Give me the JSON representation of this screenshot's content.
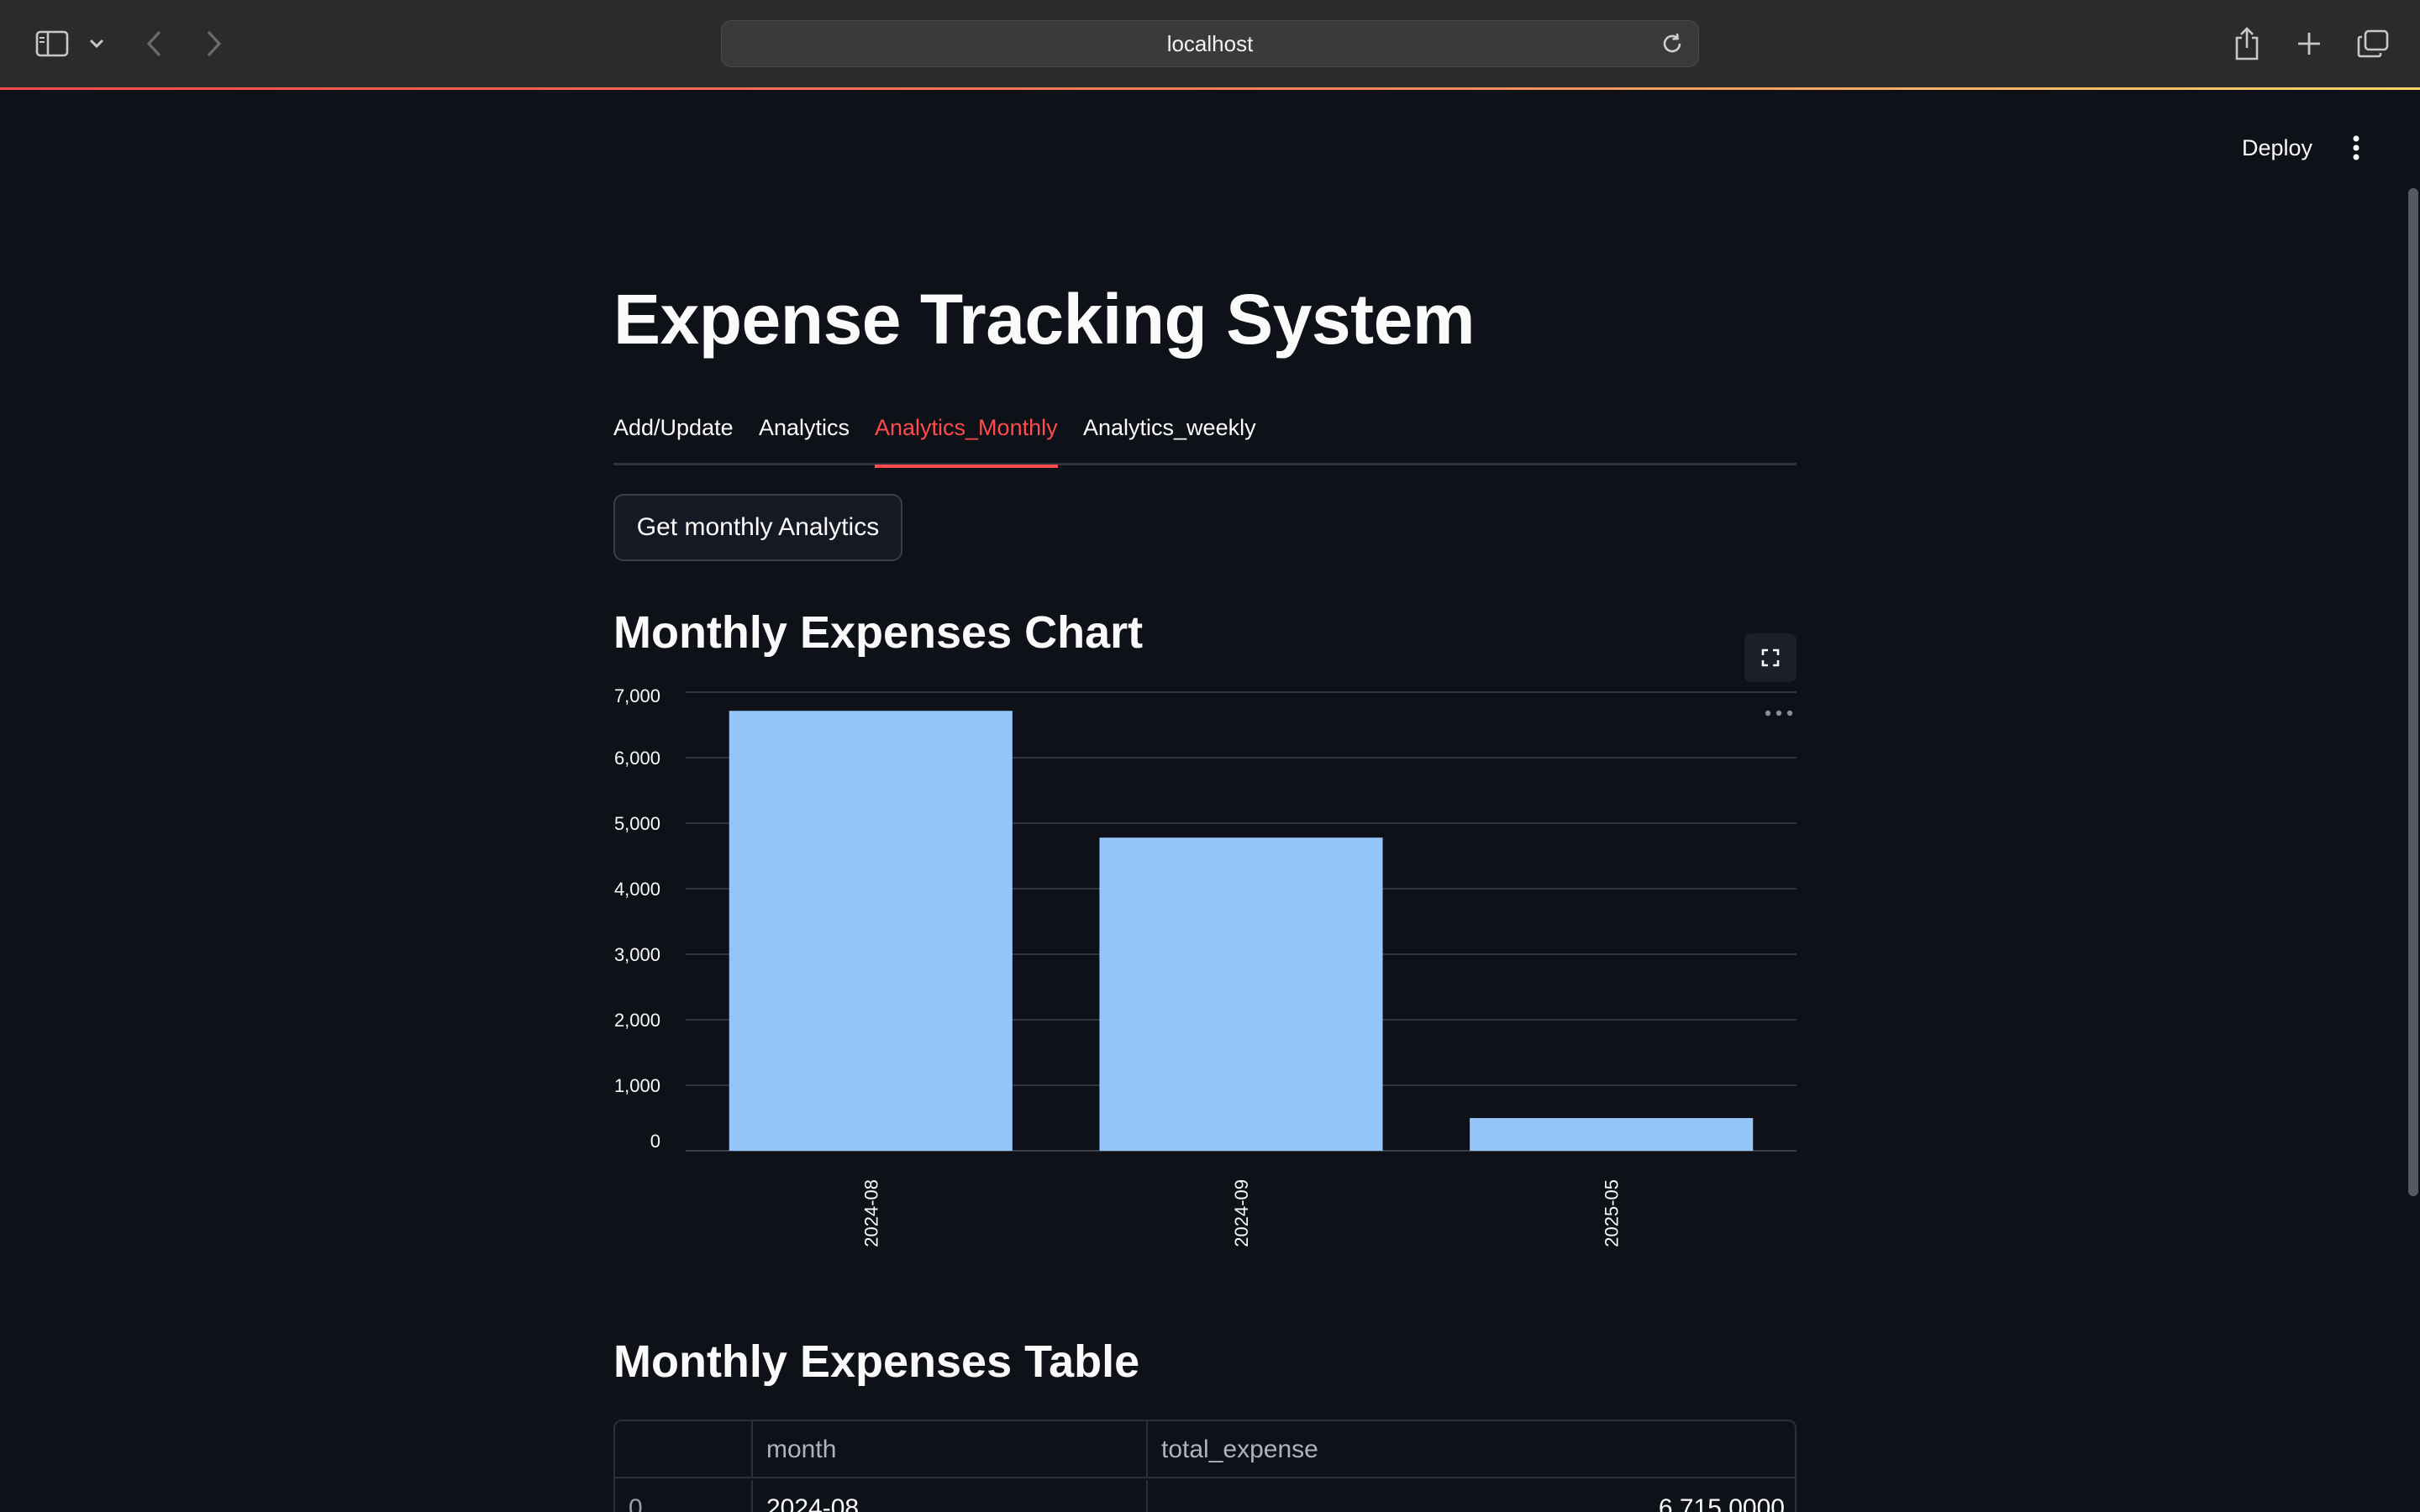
{
  "browser": {
    "address": "localhost"
  },
  "header": {
    "deploy_label": "Deploy"
  },
  "app": {
    "title": "Expense Tracking System",
    "tabs": [
      {
        "label": "Add/Update",
        "active": false
      },
      {
        "label": "Analytics",
        "active": false
      },
      {
        "label": "Analytics_Monthly",
        "active": true
      },
      {
        "label": "Analytics_weekly",
        "active": false
      }
    ],
    "button_label": "Get monthly Analytics",
    "chart_heading": "Monthly Expenses Chart",
    "table_heading": "Monthly Expenses Table",
    "table": {
      "columns": [
        "",
        "month",
        "total_expense"
      ],
      "rows": [
        {
          "index": "0",
          "month": "2024-08",
          "total_expense": "6,715.0000"
        }
      ]
    }
  },
  "colors": {
    "accent": "#ff4b4b",
    "bar": "#93c5f8",
    "background": "#0e1117"
  },
  "icons": [
    "sidebar-icon",
    "chevron-down-icon",
    "back-icon",
    "forward-icon",
    "reload-icon",
    "share-icon",
    "new-tab-icon",
    "tabs-overview-icon",
    "kebab-menu-icon",
    "fullscreen-icon",
    "more-options-icon"
  ],
  "chart_data": {
    "type": "bar",
    "categories": [
      "2024-08",
      "2024-09",
      "2025-05"
    ],
    "values": [
      6715,
      4780,
      500
    ],
    "ylim": [
      0,
      7000
    ],
    "yticks": [
      0,
      1000,
      2000,
      3000,
      4000,
      5000,
      6000,
      7000
    ],
    "title": "",
    "xlabel": "",
    "ylabel": "",
    "grid": true,
    "legend": "none"
  }
}
